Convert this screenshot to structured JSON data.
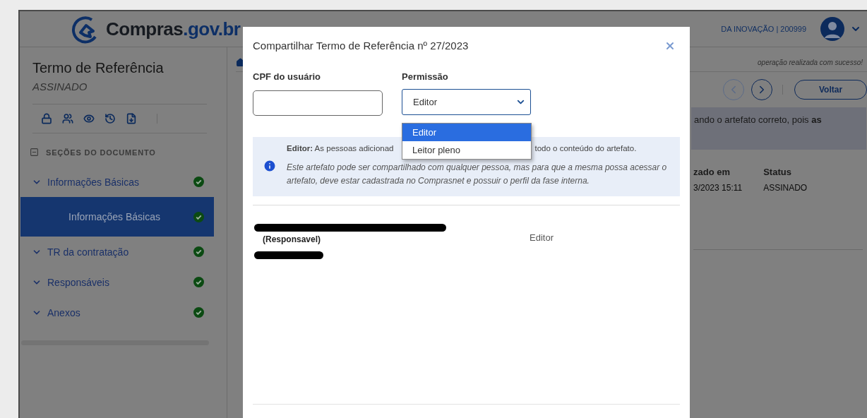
{
  "header": {
    "logo": {
      "name": "Compras",
      "domain": ".gov.br"
    },
    "organization": "DA INOVAÇÃO | 200999"
  },
  "sidebar": {
    "title": "Termo de Referência",
    "status": "ASSINADO",
    "sections_label": "SEÇÕES DO DOCUMENTO",
    "items": [
      {
        "label": "Informações Básicas",
        "done": true,
        "selected": false,
        "children": [
          {
            "label": "Informações Básicas",
            "done": true,
            "selected": true
          }
        ]
      },
      {
        "label": "TR da contratação",
        "done": true,
        "selected": false
      },
      {
        "label": "Responsáveis",
        "done": true,
        "selected": false
      },
      {
        "label": "Anexos",
        "done": true,
        "selected": false
      }
    ]
  },
  "main": {
    "message": "operação realizada com sucesso!",
    "nav": [
      {
        "kind": "prev",
        "disabled": true
      },
      {
        "kind": "next",
        "disabled": false
      }
    ],
    "back_button": "Voltar",
    "alert": "ando o artefato correto, pois **as**",
    "fields": [
      {
        "label": "zado em",
        "value": "3/2023 15:11"
      },
      {
        "label": "Status",
        "value": "ASSINADO"
      }
    ]
  },
  "modal": {
    "title": "Compartilhar Termo de Referência nº 27/2023",
    "cpf": {
      "label": "CPF do usuário"
    },
    "permission": {
      "label": "Permissão",
      "value": "Editor",
      "options": [
        {
          "label": "Editor",
          "selected": true
        },
        {
          "label": "Leitor pleno",
          "selected": false
        }
      ]
    },
    "info": {
      "lead": "**Editor:** As pessoas adicionad",
      "tail": "todo o conteúdo do artefato.",
      "note": "Este artefato pode ser compartilhado com qualquer pessoa, mas para que a mesma possa acessar o artefato, deve estar cadastrada no Comprasnet e possuir o perfil da fase interna."
    },
    "members": [
      {
        "role_note": "(Responsavel)",
        "permission": "Editor"
      }
    ]
  }
}
